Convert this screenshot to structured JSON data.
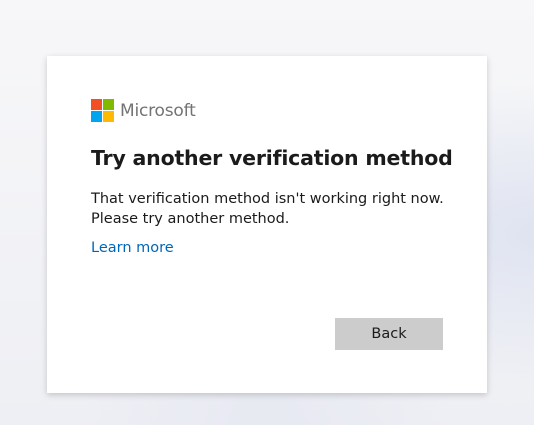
{
  "brand": {
    "name": "Microsoft",
    "logo_colors": [
      "#f25022",
      "#7fba00",
      "#00a4ef",
      "#ffb900"
    ]
  },
  "dialog": {
    "title": "Try another verification method",
    "message_line1": "That verification method isn't working right now.",
    "message_line2": "Please try another method.",
    "learn_more_label": "Learn more",
    "back_label": "Back"
  },
  "colors": {
    "link": "#0067b8",
    "button_bg": "#cccccc",
    "text": "#1b1b1b"
  }
}
